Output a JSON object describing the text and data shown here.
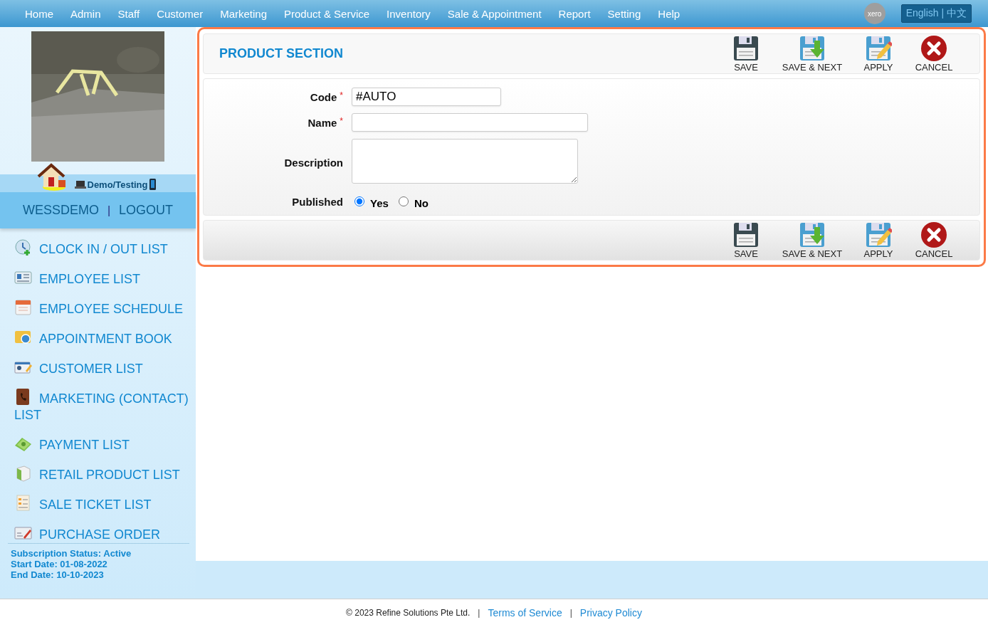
{
  "nav": {
    "items": [
      "Home",
      "Admin",
      "Staff",
      "Customer",
      "Marketing",
      "Product & Service",
      "Inventory",
      "Sale & Appointment",
      "Report",
      "Setting",
      "Help"
    ],
    "xero": "xero",
    "language": "English | 中文"
  },
  "sidebar": {
    "photo": {
      "kind": "picture"
    },
    "user": "Demo/Testing",
    "account": {
      "name": "WESSDEMO",
      "separator": "|",
      "logout": "LOGOUT"
    },
    "menu": [
      "CLOCK IN / OUT LIST",
      "EMPLOYEE LIST",
      "EMPLOYEE SCHEDULE",
      "APPOINTMENT BOOK",
      "CUSTOMER LIST",
      "MARKETING (CONTACT) LIST",
      "PAYMENT LIST",
      "RETAIL PRODUCT LIST",
      "SALE TICKET LIST",
      "PURCHASE ORDER"
    ],
    "subscription": [
      "Subscription Status: Active",
      "Start Date: 01-08-2022",
      "End Date: 10-10-2023"
    ]
  },
  "product_section": {
    "title": "PRODUCT SECTION",
    "top_toolbar": [
      {
        "label": "SAVE",
        "kind": "save"
      },
      {
        "label": "SAVE & NEXT",
        "kind": "next"
      },
      {
        "label": "APPLY",
        "kind": "apply"
      },
      {
        "label": "CANCEL",
        "kind": "cancel"
      }
    ],
    "fields": [
      {
        "label": "Code",
        "required_mark": "*",
        "kind": "text",
        "value": "#AUTO"
      },
      {
        "label": "Name",
        "required_mark": "*",
        "kind": "text"
      },
      {
        "label": "Description",
        "kind": "textarea"
      },
      {
        "label": "Published",
        "kind": "radio",
        "options": [
          {
            "label": "Yes",
            "selected": true
          },
          {
            "label": "No",
            "selected": false
          }
        ]
      }
    ],
    "bottom_toolbar": [
      {
        "label": "SAVE",
        "kind": "save"
      },
      {
        "label": "SAVE & NEXT",
        "kind": "next"
      },
      {
        "label": "APPLY",
        "kind": "apply"
      },
      {
        "label": "CANCEL",
        "kind": "cancel"
      }
    ]
  },
  "footer": {
    "copyright": "© 2023 Refine Solutions Pte Ltd.",
    "separators": [
      "|",
      "|"
    ],
    "links": [
      "Terms of Service",
      "Privacy Policy"
    ]
  }
}
